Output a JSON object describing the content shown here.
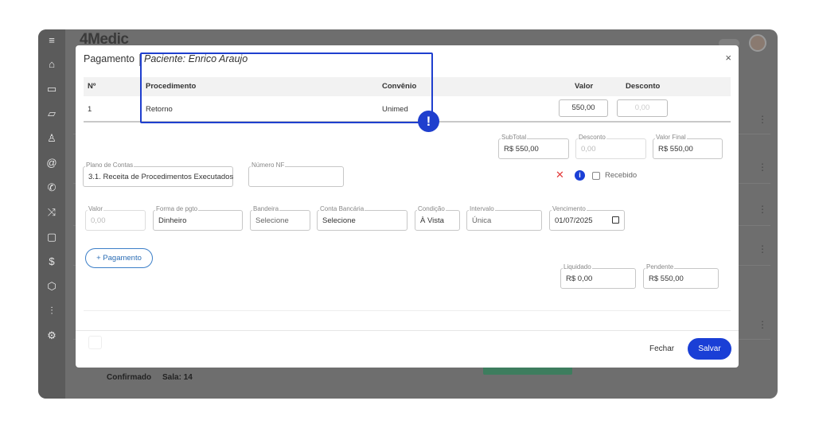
{
  "app": {
    "logo_main": "4Medic",
    "logo_trademark": ""
  },
  "background": {
    "status_text": "Confirmado",
    "room_text": "Sala: 14"
  },
  "modal": {
    "title": "Pagamento",
    "patient": "Paciente: Enrico Araujo",
    "close_icon": "×",
    "table": {
      "headers": [
        "Nº",
        "Procedimento",
        "Convênio",
        "Valor",
        "Desconto"
      ],
      "rows": [
        {
          "num": "1",
          "procedimento": "Retorno",
          "convenio": "Unimed",
          "valor": "550,00",
          "desconto": "0,00"
        }
      ]
    },
    "summary": {
      "subtotal_label": "SubTotal",
      "subtotal_value": "R$ 550,00",
      "desconto_label": "Desconto",
      "desconto_value": "0,00",
      "valor_final_label": "Valor Final",
      "valor_final_value": "R$ 550,00"
    },
    "plano_contas": {
      "label": "Plano de Contas",
      "value": "3.1. Receita de Procedimentos Executados"
    },
    "numero_nf": {
      "label": "Número NF",
      "value": ""
    },
    "payment": {
      "valor_label": "Valor",
      "valor_value": "0,00",
      "forma_label": "Forma de pgto",
      "forma_value": "Dinheiro",
      "bandeira_label": "Bandeira",
      "bandeira_value": "Selecione",
      "conta_label": "Conta Bancária",
      "conta_value": "Selecione",
      "condicao_label": "Condição",
      "condicao_value": "À Vista",
      "intervalo_label": "Intervalo",
      "intervalo_value": "Única",
      "vencimento_label": "Vencimento",
      "vencimento_value": "01/07/2025",
      "remove_icon": "✕",
      "info_icon": "i",
      "recebido_label": "Recebido"
    },
    "add_payment_label": "+ Pagamento",
    "totals": {
      "liquidado_label": "Liquidado",
      "liquidado_value": "R$ 0,00",
      "pendente_label": "Pendente",
      "pendente_value": "R$ 550,00"
    },
    "footer": {
      "fechar_label": "Fechar",
      "salvar_label": "Salvar"
    }
  },
  "annotation": {
    "alert_symbol": "!",
    "highlight_color": "#1f3fce"
  }
}
